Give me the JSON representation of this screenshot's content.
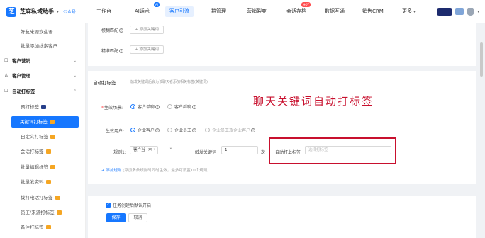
{
  "brand": {
    "name": "芝麻私域助手",
    "tag": "公众号",
    "caret": "▾"
  },
  "nav": [
    {
      "label": "工作台"
    },
    {
      "label": "AI话术",
      "badge": "AI"
    },
    {
      "label": "客户引流"
    },
    {
      "label": "群管理"
    },
    {
      "label": "营销裂变"
    },
    {
      "label": "会话存档",
      "badge": "HOT"
    },
    {
      "label": "数据互通"
    },
    {
      "label": "销售CRM"
    },
    {
      "label": "更多"
    }
  ],
  "sidebar": {
    "items": [
      {
        "label": "好友来源欢迎语"
      },
      {
        "label": "批量添加线索客户"
      },
      {
        "label": "客户营销"
      },
      {
        "label": "客户管理"
      },
      {
        "label": "自动打标签"
      },
      {
        "label": "预打标签"
      },
      {
        "label": "关键词打标签"
      },
      {
        "label": "自定义打标签"
      },
      {
        "label": "会话打标签"
      },
      {
        "label": "批量编辑标签"
      },
      {
        "label": "批量发资料"
      },
      {
        "label": "拨打电话打标签"
      },
      {
        "label": "员工/来源打标签"
      },
      {
        "label": "备注打标签"
      }
    ]
  },
  "match": {
    "fuzzy_label": "模糊匹配",
    "exact_label": "精准匹配",
    "add_keyword": "+ 添加关键词"
  },
  "auto_tag": {
    "title": "自动打标签",
    "hint": "触发关键词后会为该聊天者添加相关标签(关键词)",
    "scene_label": "生效场景:",
    "scene_options": [
      "客户单聊",
      "客户群聊"
    ],
    "users_label": "生效用户:",
    "user_options": [
      "企业客户",
      "企业员工",
      "企业员工及企业客户"
    ],
    "rule": {
      "label": "规则1:",
      "source": "客户当",
      "period": "天",
      "trigger_label": "触发关键词",
      "count": "1",
      "unit": "次",
      "tag_label": "自动打上标签",
      "tag_placeholder": "选择打标签"
    },
    "add_rule": "+ 添加规则",
    "add_rule_hint": "(添加多条规则时同时生效，最多可设置10个规则)"
  },
  "annotation": "聊天关键词自动打标签",
  "footer": {
    "checkbox_label": "任务创建后默认开启",
    "save": "保存",
    "cancel": "取消"
  }
}
